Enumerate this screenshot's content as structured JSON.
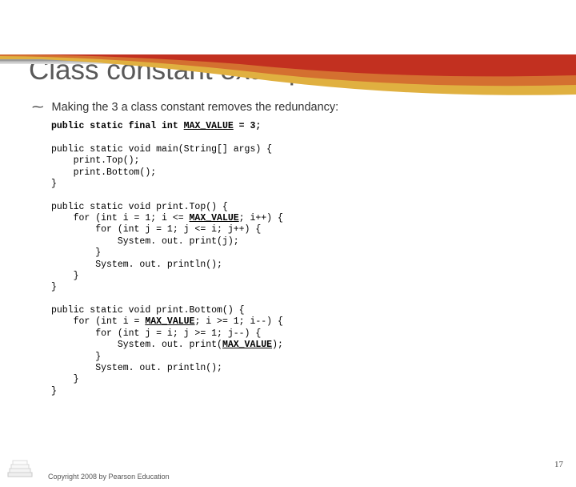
{
  "stripes": [
    "#c23020",
    "#d47030",
    "#e0b040",
    "#9a9a9a",
    "#bababa",
    "#dcdcdc"
  ],
  "curve_colors": {
    "outer": "#e0b040",
    "mid": "#d47030",
    "inner": "#c23020"
  },
  "title": "Class constant example",
  "bullet": "Making the 3 a class constant removes the redundancy:",
  "code_lines": [
    {
      "t": "public static final int ",
      "b": true
    },
    {
      "t": "MAX_VALUE",
      "b": true,
      "u": true
    },
    {
      "t": " = 3;",
      "b": true
    },
    {
      "nl": 1
    },
    {
      "nl": 1
    },
    {
      "t": "public static void main(String[] args) {"
    },
    {
      "nl": 1
    },
    {
      "t": "    print.Top();"
    },
    {
      "nl": 1
    },
    {
      "t": "    print.Bottom();"
    },
    {
      "nl": 1
    },
    {
      "t": "}"
    },
    {
      "nl": 1
    },
    {
      "nl": 1
    },
    {
      "t": "public static void print.Top() {"
    },
    {
      "nl": 1
    },
    {
      "t": "    for (int i = 1; i <= "
    },
    {
      "t": "MAX_VALUE",
      "b": true,
      "u": true
    },
    {
      "t": "; i++) {"
    },
    {
      "nl": 1
    },
    {
      "t": "        for (int j = 1; j <= i; j++) {"
    },
    {
      "nl": 1
    },
    {
      "t": "            System. out. print(j);"
    },
    {
      "nl": 1
    },
    {
      "t": "        }"
    },
    {
      "nl": 1
    },
    {
      "t": "        System. out. println();"
    },
    {
      "nl": 1
    },
    {
      "t": "    }"
    },
    {
      "nl": 1
    },
    {
      "t": "}"
    },
    {
      "nl": 1
    },
    {
      "nl": 1
    },
    {
      "t": "public static void print.Bottom() {"
    },
    {
      "nl": 1
    },
    {
      "t": "    for (int i = "
    },
    {
      "t": "MAX_VALUE",
      "b": true,
      "u": true
    },
    {
      "t": "; i >= 1; i--) {"
    },
    {
      "nl": 1
    },
    {
      "t": "        for (int j = i; j >= 1; j--) {"
    },
    {
      "nl": 1
    },
    {
      "t": "            System. out. print("
    },
    {
      "t": "MAX_VALUE",
      "b": true,
      "u": true
    },
    {
      "t": ");"
    },
    {
      "nl": 1
    },
    {
      "t": "        }"
    },
    {
      "nl": 1
    },
    {
      "t": "        System. out. println();"
    },
    {
      "nl": 1
    },
    {
      "t": "    }"
    },
    {
      "nl": 1
    },
    {
      "t": "}"
    },
    {
      "nl": 1
    }
  ],
  "copyright": "Copyright 2008 by Pearson Education",
  "page_number": "17"
}
